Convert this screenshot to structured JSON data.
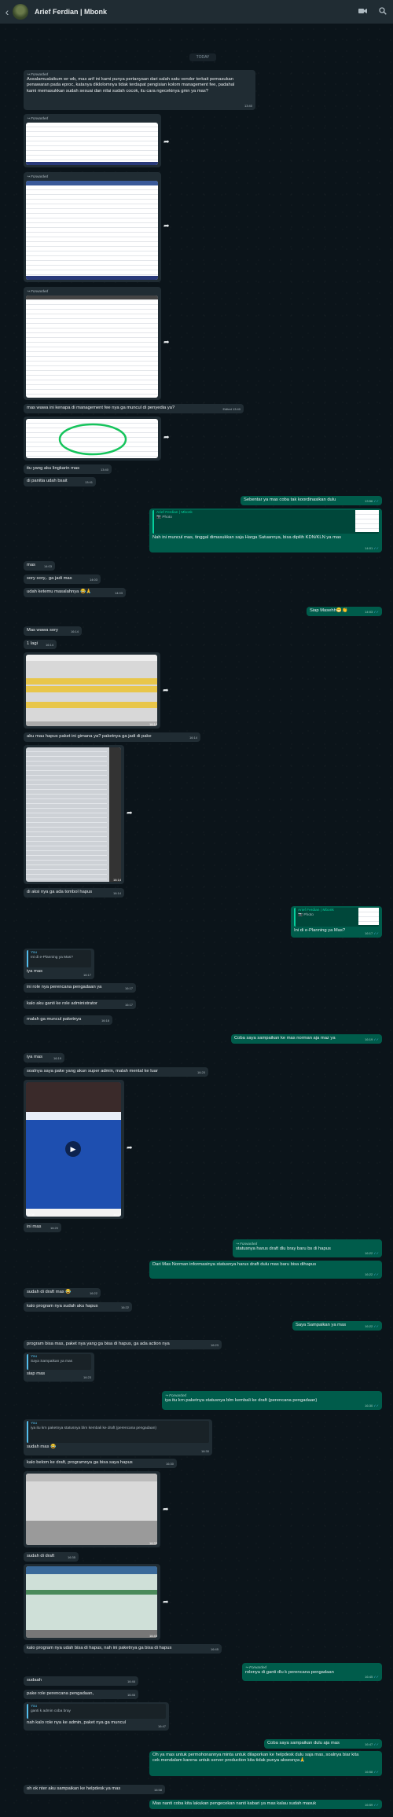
{
  "header": {
    "title": "Arief Ferdian | Mbonk",
    "back_icon": "back-arrow-icon",
    "video_icon": "video-call-icon",
    "search_icon": "search-icon"
  },
  "day": "TODAY",
  "labels": {
    "forwarded": "Forwarded",
    "you": "You",
    "photo": "Photo",
    "edited": "Edited"
  },
  "messages": {
    "m1": {
      "text": "Assalamualaikum wr wb, mas arif ini kami punya pertanyaan dari salah satu vendor terkait pemasukan penawaran pada eproc, katanya diklolomnya tidak terdapat pengisian kolom management fee, padahal kami memasukkan sudah sesuai dan nilai sudah cocok, itu cara ngecekinya gmn ya mas?",
      "time": "13:40"
    },
    "m2": {
      "text": "mas wawa ini kenapa di management fee nya ga muncul di penyedia ya?",
      "time": "13:40"
    },
    "m3": {
      "text": "itu yang aku lingkarin mas",
      "time": "13:40"
    },
    "m4": {
      "text": "di panitia udah bsait",
      "time": "13:41"
    },
    "m5": {
      "text": "Sebentar ya mas coba tak koordinasikan dulu",
      "time": "13:56"
    },
    "m6": {
      "quote_name": "Arief Ferdian | Mbonk",
      "text": "Nah ini muncul mas, tinggal dimasukkan saja Harga Satuannya, bisa dipilih KDN/KLN ya mas",
      "time": "14:01"
    },
    "m7": {
      "text": "mas",
      "time": "14:03"
    },
    "m8": {
      "text": "sory sory,. ga jadi mas",
      "time": "14:03"
    },
    "m9": {
      "text": "udah ketemu masalahnya 😂🙏",
      "time": "14:03"
    },
    "m10": {
      "text": "Siap Masehh😁👏",
      "time": "14:03"
    },
    "m11": {
      "text": "Mas wawa sory",
      "time": "16:14"
    },
    "m12": {
      "text": "1 lagi",
      "time": "16:14"
    },
    "m12b": {
      "time": "16:14"
    },
    "m13": {
      "text": "aku mau hapus paket ini gimana ya? paketnya ga jadi di pake",
      "time": "16:14"
    },
    "m13b": {
      "time": "16:14"
    },
    "m14": {
      "text": "di aksi nya ga ada tombol hapus",
      "time": "16:14"
    },
    "m15": {
      "quote_name": "Arief Ferdian | Mbonk",
      "text": "Ini di e-Planning ya Mas?",
      "time": "16:17"
    },
    "m16": {
      "quote_text": "Ini di e-Planning ya Mas?",
      "text": "iya mas",
      "time": "16:17"
    },
    "m17": {
      "text": "ini role nya perencana pengadaan ya",
      "time": "16:17"
    },
    "m18": {
      "text": "kalo aku ganti ke role administrator",
      "time": "16:17"
    },
    "m19": {
      "text": "malah ga muncul paketnya",
      "time": "16:18"
    },
    "m20": {
      "text": "Coba saya sampaikan ke mas norman aja maz ya",
      "time": "16:19"
    },
    "m21": {
      "text": "iya mas",
      "time": "16:19"
    },
    "m22": {
      "text": "soalnya saya pake yang akun super admin, malah mental ke luar",
      "time": "16:20"
    },
    "m22b": {
      "time": "16:20",
      "duration": "0:08"
    },
    "m23": {
      "text": "ini mas",
      "time": "16:20"
    },
    "m24": {
      "text": "statusnya harus draft dlu bray baru bs di hapus",
      "time": "16:22"
    },
    "m25": {
      "text": "Dari Mas Norman informasinya statusnya harus draft dulu mas baru bisa dihapus",
      "time": "16:22"
    },
    "m26": {
      "text": "sudah di draft mas 😂",
      "time": "16:22"
    },
    "m27": {
      "text": "kalo program nya sudah aku hapus",
      "time": "16:22"
    },
    "m28": {
      "text": "Saya Sampaikan ya mas",
      "time": "16:22"
    },
    "m29": {
      "text": "program bisa mas, paket nya yang ga bisa di hapus, ga ada action nya",
      "time": "16:23"
    },
    "m30": {
      "quote_text": "Saya Sampaikan ya mas",
      "text": "siap mas",
      "time": "16:23"
    },
    "m31": {
      "text": "iya itu krn paketnya statusnya blm kembali ke draft (perencana pengadaan)",
      "time": "16:30"
    },
    "m32": {
      "quote_text": "iya itu krn paketnya statusnya blm kembali ke draft (perencana pengadaan)",
      "text": "sudah mas 😂",
      "time": "16:30"
    },
    "m33": {
      "text": "kalo belom ke draft, programnya ga bisa saya hapus",
      "time": "16:30"
    },
    "m33b": {
      "time": "16:33"
    },
    "m34": {
      "text": "sudah di draft",
      "time": "16:35"
    },
    "m34b": {
      "time": "16:43"
    },
    "m35": {
      "text": "kalo program nya udah bisa di hapus, nah ini paketnya ga bisa di hapus",
      "time": "16:45"
    },
    "m36": {
      "text": "rolenya di ganti dlu k perencana pengadaan",
      "time": "16:45"
    },
    "m37": {
      "text": "sudaah",
      "time": "16:46"
    },
    "m38": {
      "text": "pake role perencana pengadaan,",
      "time": "16:46"
    },
    "m39": {
      "quote_text": "ganti k admin coba bray",
      "text": "nah kalo role nya ke admin, paket nya ga muncul",
      "time": "16:47"
    },
    "m40": {
      "text": "Coba saya sampaikan dulu aja mas",
      "time": "16:47"
    },
    "m41": {
      "text": "Oh ya mas untuk permohonannya minta untuk dilaporkan ke helpdesk dulu saja mas, soalnya biar kita cek mendalam karena untuk server production kita tidak punya aksesnya🙏",
      "time": "16:58"
    },
    "m42": {
      "text": "oh ok nter aku sampaikan ke helpdesk ya mas",
      "time": "16:58"
    },
    "m43": {
      "text": "Mas nanti coba kita lakukan pengecekan nanti kabari ya mas kalau sudah masuk",
      "time": "16:59"
    }
  }
}
